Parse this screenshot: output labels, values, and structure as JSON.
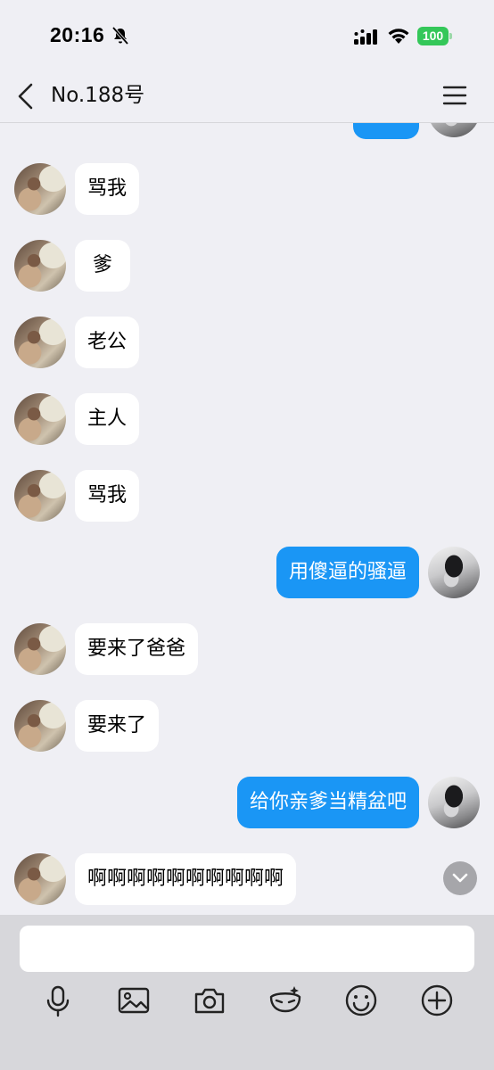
{
  "status": {
    "time": "20:16",
    "battery": "100"
  },
  "nav": {
    "title": "No.188号"
  },
  "messages": [
    {
      "side": "left",
      "text": "骂我"
    },
    {
      "side": "left",
      "text": "爹"
    },
    {
      "side": "left",
      "text": "老公"
    },
    {
      "side": "left",
      "text": "主人"
    },
    {
      "side": "left",
      "text": "骂我"
    },
    {
      "side": "right",
      "text": "用傻逼的骚逼"
    },
    {
      "side": "left",
      "text": "要来了爸爸"
    },
    {
      "side": "left",
      "text": "要来了"
    },
    {
      "side": "right",
      "text": "给你亲爹当精盆吧"
    },
    {
      "side": "left",
      "text": "啊啊啊啊啊啊啊啊啊啊"
    }
  ],
  "input": {
    "placeholder": ""
  },
  "toolbar": [
    "microphone-icon",
    "image-icon",
    "camera-icon",
    "mask-icon",
    "emoji-icon",
    "plus-icon"
  ],
  "colors": {
    "accent": "#1a96f5",
    "background": "#efeff4",
    "battery": "#34c759"
  }
}
